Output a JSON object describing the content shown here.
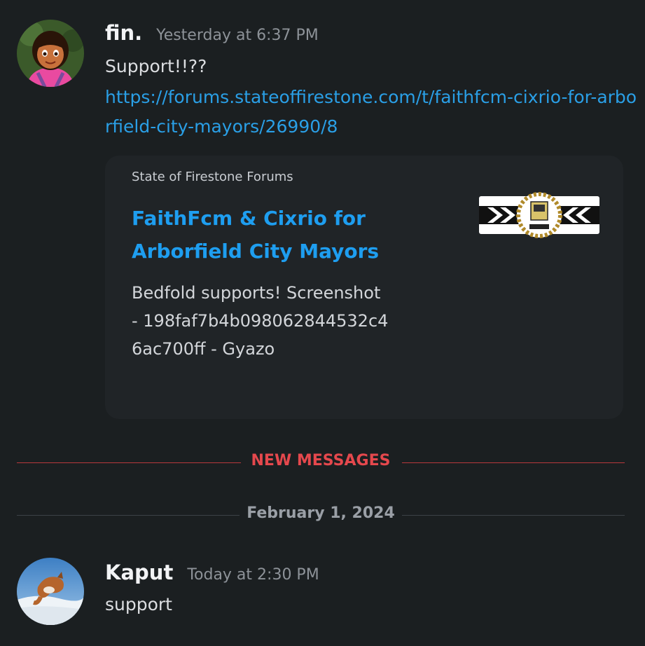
{
  "messages": [
    {
      "author": "fin.",
      "timestamp": "Yesterday at 6:37 PM",
      "text": "Support!!??",
      "link": "https://forums.stateoffirestone.com/t/faithfcm-cixrio-for-arborfield-city-mayors/26990/8",
      "embed": {
        "provider": "State of Firestone Forums",
        "title": "FaithFcm & Cixrio for Arborfield City Mayors",
        "description": "Bedfold supports! Screenshot - 198faf7b4b098062844532c46ac700ff - Gyazo"
      }
    },
    {
      "author": "Kaput",
      "timestamp": "Today at 2:30 PM",
      "text": "support"
    }
  ],
  "dividers": {
    "new_messages": "NEW MESSAGES",
    "date": "February 1, 2024"
  },
  "colors": {
    "background": "#1b1f21",
    "link": "#2a9fe6",
    "new_messages": "#e5484d",
    "embed_background": "#202427"
  }
}
